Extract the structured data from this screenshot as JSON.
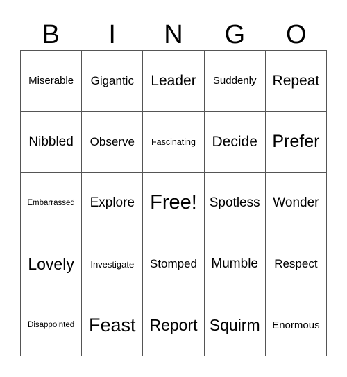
{
  "header": [
    "B",
    "I",
    "N",
    "G",
    "O"
  ],
  "cells": [
    [
      "Miserable",
      "Gigantic",
      "Leader",
      "Suddenly",
      "Repeat"
    ],
    [
      "Nibbled",
      "Observe",
      "Fascinating",
      "Decide",
      "Prefer"
    ],
    [
      "Embarrassed",
      "Explore",
      "Free!",
      "Spotless",
      "Wonder"
    ],
    [
      "Lovely",
      "Investigate",
      "Stomped",
      "Mumble",
      "Respect"
    ],
    [
      "Disappointed",
      "Feast",
      "Report",
      "Squirm",
      "Enormous"
    ]
  ]
}
